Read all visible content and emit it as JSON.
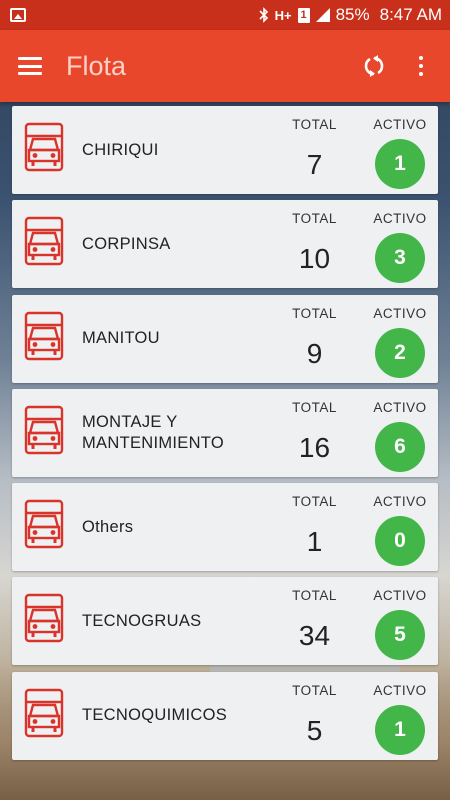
{
  "status_bar": {
    "battery": "85%",
    "time": "8:47 AM",
    "network": "H+",
    "sim": "1",
    "icons": [
      "gallery-icon",
      "bluetooth-icon",
      "network-icon",
      "sim-icon",
      "signal-icon"
    ]
  },
  "app_bar": {
    "title": "Flota",
    "accent_color": "#e8472b",
    "icons": [
      "menu-icon",
      "refresh-icon",
      "more-vert-icon"
    ]
  },
  "fleets": [
    {
      "name": "CHIRIQUI",
      "total_label": "TOTAL",
      "total": "7",
      "active_label": "ACTIVO",
      "active": "1"
    },
    {
      "name": "CORPINSA",
      "total_label": "TOTAL",
      "total": "10",
      "active_label": "ACTIVO",
      "active": "3"
    },
    {
      "name": "MANITOU",
      "total_label": "TOTAL",
      "total": "9",
      "active_label": "ACTIVO",
      "active": "2"
    },
    {
      "name": "MONTAJE Y MANTENIMIENTO",
      "total_label": "TOTAL",
      "total": "16",
      "active_label": "ACTIVO",
      "active": "6"
    },
    {
      "name": "Others",
      "total_label": "TOTAL",
      "total": "1",
      "active_label": "ACTIVO",
      "active": "0"
    },
    {
      "name": "TECNOGRUAS",
      "total_label": "TOTAL",
      "total": "34",
      "active_label": "ACTIVO",
      "active": "5"
    },
    {
      "name": "TECNOQUIMICOS",
      "total_label": "TOTAL",
      "total": "5",
      "active_label": "ACTIVO",
      "active": "1"
    }
  ],
  "colors": {
    "truck_icon": "#d9342b",
    "active_badge": "#43b649",
    "status_bar": "#c8301c"
  }
}
